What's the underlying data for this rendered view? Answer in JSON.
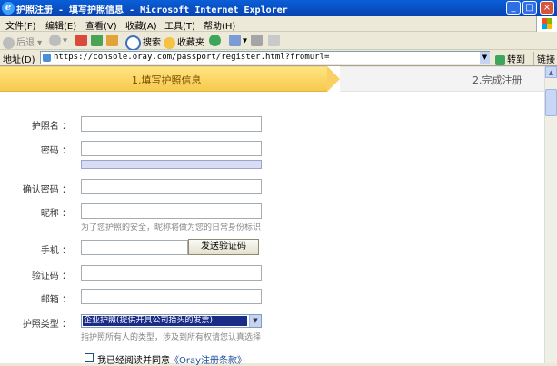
{
  "window": {
    "title": "护照注册 - 填写护照信息 - Microsoft Internet Explorer",
    "minimize": "_",
    "maximize": "□",
    "close": "×"
  },
  "menubar": [
    "文件(F)",
    "编辑(E)",
    "查看(V)",
    "收藏(A)",
    "工具(T)",
    "帮助(H)"
  ],
  "toolbar": {
    "back": "后退",
    "search": "搜索",
    "favorites": "收藏夹"
  },
  "address": {
    "label": "地址(D)",
    "url": "https://console.oray.com/passport/register.html?fromurl=",
    "go": "转到",
    "links": "链接"
  },
  "steps": [
    {
      "label": "1.填写护照信息",
      "active": true
    },
    {
      "label": "2.完成注册",
      "active": false
    }
  ],
  "form": {
    "passport_name_label": "护照名 ：",
    "password_label": "密码 ：",
    "confirm_password_label": "确认密码 ：",
    "nickname_label": "昵称 ：",
    "nickname_hint": "为了您护照的安全，昵称将做为您的日常身份标识",
    "phone_label": "手机 ：",
    "send_code_button": "发送验证码",
    "code_label": "验证码 ：",
    "email_label": "邮箱 ：",
    "type_label": "护照类型 ：",
    "type_selected": "企业护照(提供开具公司抬头的发票)",
    "type_hint": "指护照所有人的类型，涉及到所有权请您认真选择",
    "agree_text": "我已经阅读并同意",
    "agree_link": "《Oray注册条款》"
  },
  "colors": {
    "title_bar": "#0842b0",
    "step_active": "#f7c94e",
    "select_highlight": "#1a2c86"
  }
}
